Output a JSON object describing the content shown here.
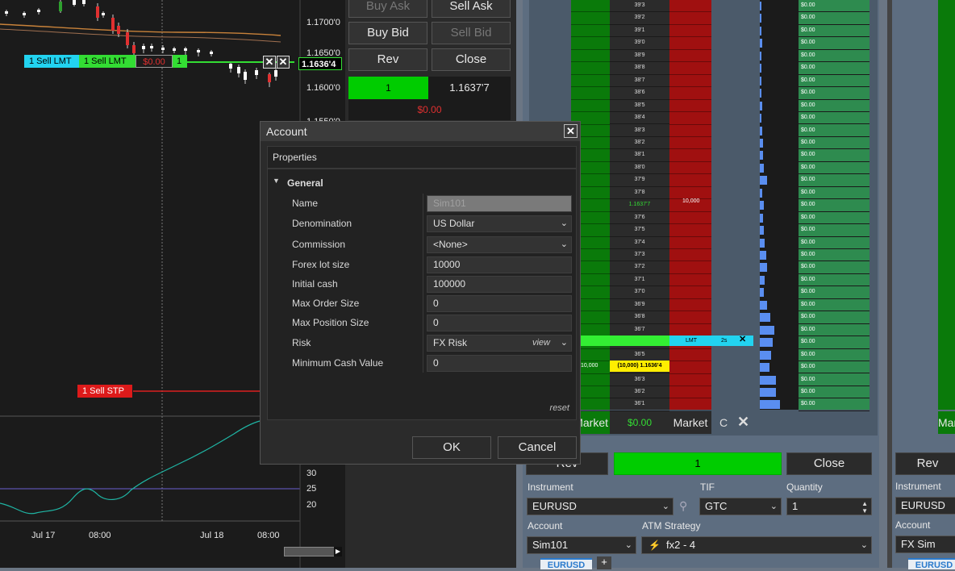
{
  "chart": {
    "price_labels": [
      "1.1700'0",
      "1.1650'0",
      "1.1600'0",
      "1.1550'0"
    ],
    "current_price": "1.1636'4",
    "order_sell_lmt_a": "1  Sell LMT",
    "order_sell_lmt_b": "1  Sell LMT",
    "order_pnl": "$0.00",
    "order_qty": "1",
    "sell_stp": "1  Sell STP",
    "indicator_labels": [
      "30",
      "25",
      "20"
    ],
    "time_labels": [
      "Jul 17",
      "08:00",
      "Jul 18",
      "08:00"
    ],
    "close_glyph": "✕"
  },
  "trader": {
    "buy_ask": "Buy Ask",
    "sell_ask": "Sell Ask",
    "buy_bid": "Buy Bid",
    "sell_bid": "Sell Bid",
    "rev": "Rev",
    "close": "Close",
    "position_qty": "1",
    "position_price": "1.1637'7",
    "pnl": "$0.00"
  },
  "dom": {
    "ladder_prices": [
      "39'3",
      "39'2",
      "39'1",
      "39'0",
      "38'9",
      "38'8",
      "38'7",
      "38'6",
      "38'5",
      "38'4",
      "38'3",
      "38'2",
      "38'1",
      "38'0",
      "37'9",
      "37'8",
      "1.1637'7",
      "37'6",
      "37'5",
      "37'4",
      "37'3",
      "37'2",
      "37'1",
      "37'0",
      "36'9",
      "36'8",
      "36'7",
      "36'6",
      "36'5",
      "36'4",
      "36'3",
      "36'2",
      "36'1"
    ],
    "ask_size": "10,000",
    "bid_size": "10,000",
    "position_marker": "(10,000) 1.1636'4",
    "lmt_tag": "LMT",
    "lmt_time": "2s",
    "pnl_values": [
      "$0.00",
      "$0.00",
      "$0.00",
      "$0.00",
      "$0.00",
      "$0.00",
      "$0.00",
      "$0.00",
      "$0.00",
      "$0.00",
      "$0.00",
      "$0.00",
      "$0.00",
      "$0.00",
      "$0.00",
      "$0.00",
      "$0.00",
      "$0.00",
      "$0.00",
      "$0.00",
      "$0.00",
      "$0.00",
      "$0.00",
      "$0.00",
      "$0.00",
      "$0.00",
      "$0.00",
      "$0.00",
      "$0.00",
      "$0.00",
      "$0.00",
      "$0.00",
      "$0.00"
    ],
    "market_left": "Market",
    "market_right": "Market",
    "market_pnl": "$0.00",
    "c_label": "C",
    "rev": "Rev",
    "position_qty": "1",
    "close": "Close",
    "instrument_label": "Instrument",
    "instrument_value": "EURUSD",
    "tif_label": "TIF",
    "tif_value": "GTC",
    "quantity_label": "Quantity",
    "quantity_value": "1",
    "account_label": "Account",
    "account_value": "Sim101",
    "atm_label": "ATM Strategy",
    "atm_value": "fx2 - 4",
    "tab_label": "EURUSD",
    "add_tab": "+"
  },
  "dom2": {
    "market": "Mar",
    "rev": "Rev",
    "instrument_label": "Instrument",
    "instrument_value": "EURUSD",
    "account_label": "Account",
    "account_value": "FX Sim",
    "tab_label": "EURUSD"
  },
  "dialog": {
    "title": "Account",
    "close_glyph": "✕",
    "properties_header": "Properties",
    "group_label": "General",
    "fields": [
      {
        "label": "Name",
        "value": "Sim101"
      },
      {
        "label": "Denomination",
        "value": "US Dollar"
      },
      {
        "label": "Commission",
        "value": "<None>"
      },
      {
        "label": "Forex lot size",
        "value": "10000"
      },
      {
        "label": "Initial cash",
        "value": "100000"
      },
      {
        "label": "Max Order Size",
        "value": "0"
      },
      {
        "label": "Max Position Size",
        "value": "0"
      },
      {
        "label": "Risk",
        "value": "FX Risk"
      },
      {
        "label": "Minimum Cash Value",
        "value": "0"
      }
    ],
    "risk_view": "view",
    "reset": "reset",
    "ok": "OK",
    "cancel": "Cancel"
  }
}
